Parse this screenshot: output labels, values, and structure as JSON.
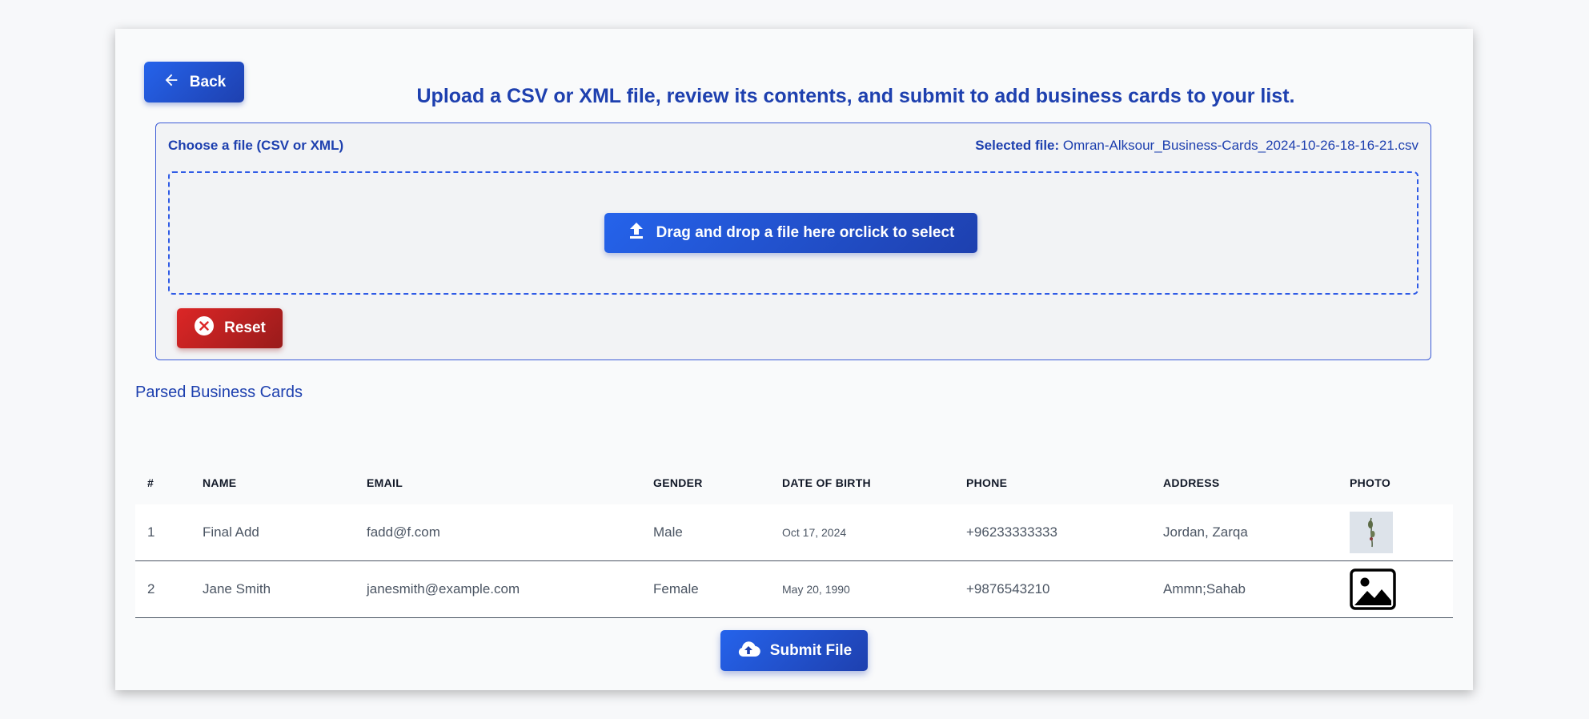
{
  "header": {
    "back_label": "Back",
    "headline": "Upload a CSV or XML file, review its contents, and submit to add business cards to your list."
  },
  "upload": {
    "choose_label": "Choose a file (CSV or XML)",
    "selected_prefix": "Selected file:",
    "selected_file": "Omran-Alksour_Business-Cards_2024-10-26-18-16-21.csv",
    "drop_label": "Drag and drop a file here orclick to select",
    "reset_label": "Reset"
  },
  "table": {
    "title": "Parsed Business Cards",
    "columns": [
      "#",
      "NAME",
      "EMAIL",
      "GENDER",
      "DATE OF BIRTH",
      "PHONE",
      "ADDRESS",
      "PHOTO"
    ],
    "rows": [
      {
        "num": "1",
        "name": "Final Add",
        "email": "fadd@f.com",
        "gender": "Male",
        "dob": "Oct 17, 2024",
        "phone": "+96233333333",
        "address": "Jordan, Zarqa",
        "photo": "image-thumbnail"
      },
      {
        "num": "2",
        "name": "Jane Smith",
        "email": "janesmith@example.com",
        "gender": "Female",
        "dob": "May 20, 1990",
        "phone": "+9876543210",
        "address": "Ammn;Sahab",
        "photo": "image-placeholder-icon"
      }
    ]
  },
  "submit_label": "Submit File",
  "colors": {
    "primary": "#1e40af",
    "danger": "#dc2626",
    "background": "#f9fafb"
  }
}
